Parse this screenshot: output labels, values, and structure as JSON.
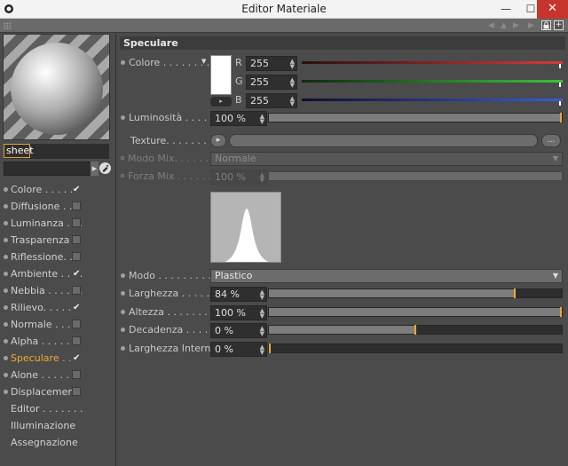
{
  "window": {
    "title": "Editor Materiale",
    "min_symbol": "—",
    "max_symbol": "☐",
    "close_symbol": "✕"
  },
  "toolbar": {
    "lock_icon": "lock-icon",
    "new_window_icon": "new-window-icon"
  },
  "left": {
    "material_name": "sheet",
    "channels": [
      {
        "label": "Colore . . . . . .",
        "checked": true,
        "active": false
      },
      {
        "label": "Diffusione . . .",
        "checked": false,
        "active": false
      },
      {
        "label": "Luminanza . . .",
        "checked": false,
        "active": false
      },
      {
        "label": "Trasparenza",
        "checked": false,
        "active": false
      },
      {
        "label": "Riflessione. . .",
        "checked": false,
        "active": false
      },
      {
        "label": "Ambiente . . . .",
        "checked": true,
        "active": false
      },
      {
        "label": "Nebbia . . . . . .",
        "checked": false,
        "active": false
      },
      {
        "label": "Rilievo. . . . . .",
        "checked": true,
        "active": false
      },
      {
        "label": "Normale . . . .",
        "checked": false,
        "active": false
      },
      {
        "label": "Alpha . . . . . .",
        "checked": false,
        "active": false
      },
      {
        "label": "Speculare . . .",
        "checked": true,
        "active": true
      },
      {
        "label": "Alone . . . . . .",
        "checked": false,
        "active": false
      },
      {
        "label": "Displacement",
        "checked": false,
        "active": false
      },
      {
        "label": "Editor . . . . . . ."
      },
      {
        "label": "Illuminazione"
      },
      {
        "label": "Assegnazione"
      }
    ]
  },
  "section": {
    "title": "Speculare"
  },
  "colore": {
    "label": "Colore . . . . . . . . .",
    "swatch_color": "#ffffff",
    "r_label": "R",
    "g_label": "G",
    "b_label": "B",
    "r_value": "255",
    "g_value": "255",
    "b_value": "255",
    "r_color": "#d83a3a",
    "g_color": "#3ac43a",
    "b_color": "#3a5ad8"
  },
  "luminosita": {
    "label": "Luminosità . . . . . . .",
    "value": "100 %",
    "fraction": 1.0
  },
  "texture": {
    "label": "Texture. . . . . . . . . . .",
    "more_label": "..."
  },
  "modo_mix": {
    "label": "Modo Mix. . . . . . . .",
    "value": "Normale"
  },
  "forza_mix": {
    "label": "Forza Mix . . . . . . .",
    "value": "100 %",
    "fraction": 1.0
  },
  "modo": {
    "label": "Modo . . . . . . . . . . . .",
    "value": "Plastico"
  },
  "larghezza": {
    "label": "Larghezza . . . . . . . .",
    "value": "84 %",
    "fraction": 0.84
  },
  "altezza": {
    "label": "Altezza . . . . . . . . . . .",
    "value": "100 %",
    "fraction": 1.0
  },
  "decadenza": {
    "label": "Decadenza . . . . . . .",
    "value": "0 %",
    "fraction": 0.5
  },
  "larghezza_interna": {
    "label": "Larghezza Interna",
    "value": "0 %",
    "fraction": 0.0
  },
  "colors": {
    "accent": "#f0a830",
    "panel": "#4b4b4b",
    "field": "#2e2e2e"
  }
}
